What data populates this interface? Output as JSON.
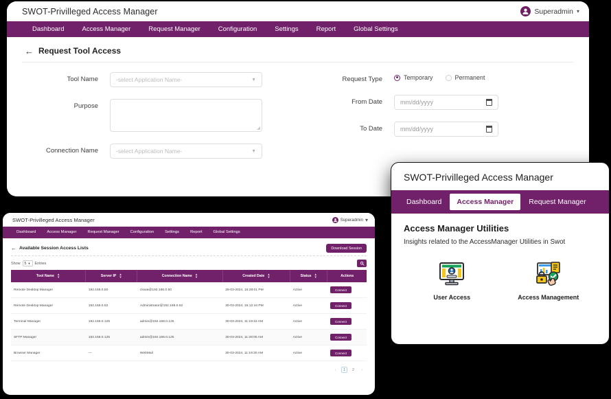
{
  "app": {
    "title": "SWOT-Privilleged Access Manager",
    "user": "Superadmin",
    "caret": "▾",
    "nav": [
      "Dashboard",
      "Access Manager",
      "Request Manager",
      "Configuration",
      "Settings",
      "Report",
      "Global Settings"
    ]
  },
  "main": {
    "back_arrow": "←",
    "page_title": "Request Tool Access",
    "left_fields": {
      "tool_name_label": "Tool Name",
      "tool_name_placeholder": "-select Application Name-",
      "purpose_label": "Purpose",
      "purpose_value": "",
      "connection_name_label": "Connection Name",
      "connection_name_placeholder": "-select Application Name-"
    },
    "right_fields": {
      "request_type_label": "Request Type",
      "options": [
        "Temporary",
        "Permanent"
      ],
      "selected": "Temporary",
      "from_date_label": "From Date",
      "from_date_placeholder": "mm/dd/yyyy",
      "to_date_label": "To Date",
      "to_date_placeholder": "mm/dd/yyyy"
    }
  },
  "list_window": {
    "title": "SWOT-Privilleged Access Manager",
    "user": "Superadmin",
    "back_arrow": "←",
    "page_title": "Available Session Access Lists",
    "download_button": "Download Session",
    "show_label": "Show",
    "entries_value": "5",
    "entries_label": "Entries",
    "search_icon": "🔍",
    "columns": [
      "Tool Name",
      "Server IP",
      "Connection Name",
      "Created Date",
      "Status",
      "Actions"
    ],
    "rows": [
      {
        "tool": "Remote Desktop Manager",
        "ip": "192.168.0.50",
        "conn": "clowa@192.168.0.50",
        "created": "29-03-2024, 16:28:01 PM",
        "status": "Active",
        "action": "Connect"
      },
      {
        "tool": "Remote Desktop Manager",
        "ip": "192.168.0.52",
        "conn": "Administrator@192.168.0.52",
        "created": "30-03-2024, 15:12:44 PM",
        "status": "Active",
        "action": "Connect"
      },
      {
        "tool": "Terminal Manager",
        "ip": "192.168.0.125",
        "conn": "admin@192.168.0.125",
        "created": "30-03-2024, 11:19:15 AM",
        "status": "Active",
        "action": "Connect"
      },
      {
        "tool": "SFTP Manager",
        "ip": "192.168.0.125",
        "conn": "admin@192.168.0.125",
        "created": "30-03-2024, 11:28:05 AM",
        "status": "Active",
        "action": "Connect"
      },
      {
        "tool": "Browser Manager",
        "ip": "—",
        "conn": "WebMail",
        "created": "30-03-2024, 11:19:30 AM",
        "status": "Active",
        "action": "Connect"
      }
    ],
    "pagination": {
      "prev": "‹",
      "pages": [
        "1",
        "2"
      ],
      "current": "1",
      "next": "›"
    }
  },
  "float_panel": {
    "title": "SWOT-Privilleged Access Manager",
    "tabs": [
      "Dashboard",
      "Access Manager",
      "Request Manager"
    ],
    "active_tab": "Access Manager",
    "heading": "Access Manager Utilities",
    "subheading": "Insights related to the AccessManager Utilities in Swot",
    "tiles": [
      {
        "label": "User Access",
        "icon": "monitor-user-access-icon"
      },
      {
        "label": "Access Management",
        "icon": "access-management-icon"
      }
    ]
  },
  "colors": {
    "brand_purple": "#71206A",
    "background": "#000000",
    "card": "#ffffff"
  }
}
